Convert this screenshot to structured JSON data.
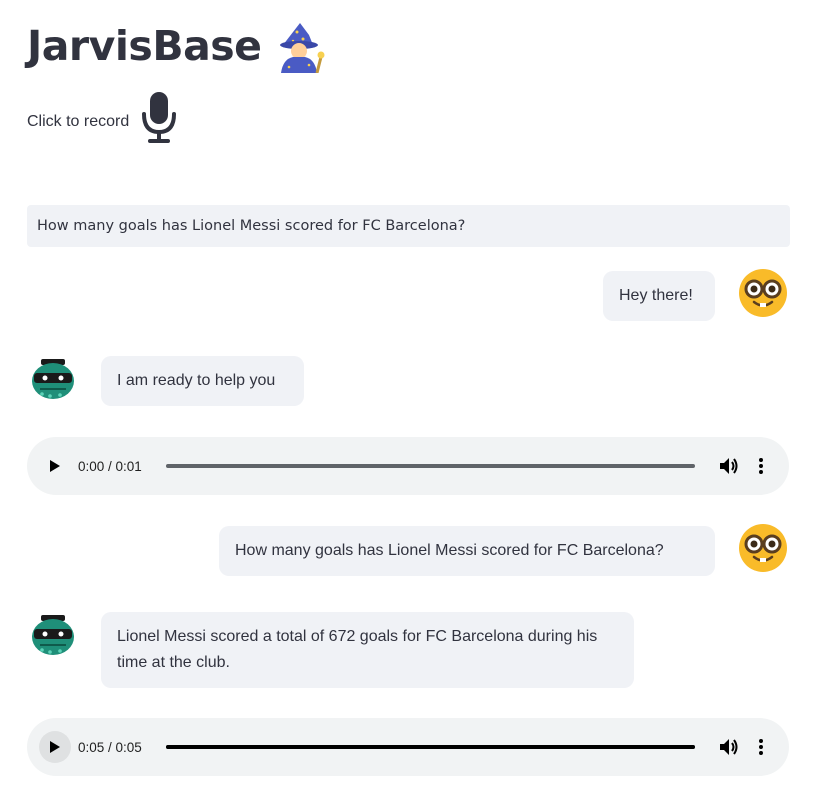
{
  "app": {
    "title": "JarvisBase",
    "title_icon": "mage-icon"
  },
  "recorder": {
    "label": "Click to record",
    "icon": "microphone-icon"
  },
  "query_input": {
    "value": "How many goals has Lionel Messi scored for FC Barcelona?"
  },
  "chat": [
    {
      "role": "user",
      "text": "Hey there!",
      "avatar": "nerd-face-emoji"
    },
    {
      "role": "bot",
      "text": "I am ready to help you",
      "avatar": "bot-avatar"
    },
    {
      "role": "audio",
      "time": "0:00 / 0:01",
      "progress": 0.0
    },
    {
      "role": "user",
      "text": "How many goals has Lionel Messi scored for FC Barcelona?",
      "avatar": "nerd-face-emoji"
    },
    {
      "role": "bot",
      "text": "Lionel Messi scored a total of 672 goals for FC Barcelona during his time at the club.",
      "avatar": "bot-avatar"
    },
    {
      "role": "audio",
      "time": "0:05 / 0:05",
      "progress": 1.0
    }
  ],
  "colors": {
    "text": "#31333f",
    "bubble_bg": "#f0f2f6",
    "audio_bg": "#f1f3f4",
    "emoji_yellow": "#f9bb29",
    "bot_teal": "#1f8f79"
  }
}
